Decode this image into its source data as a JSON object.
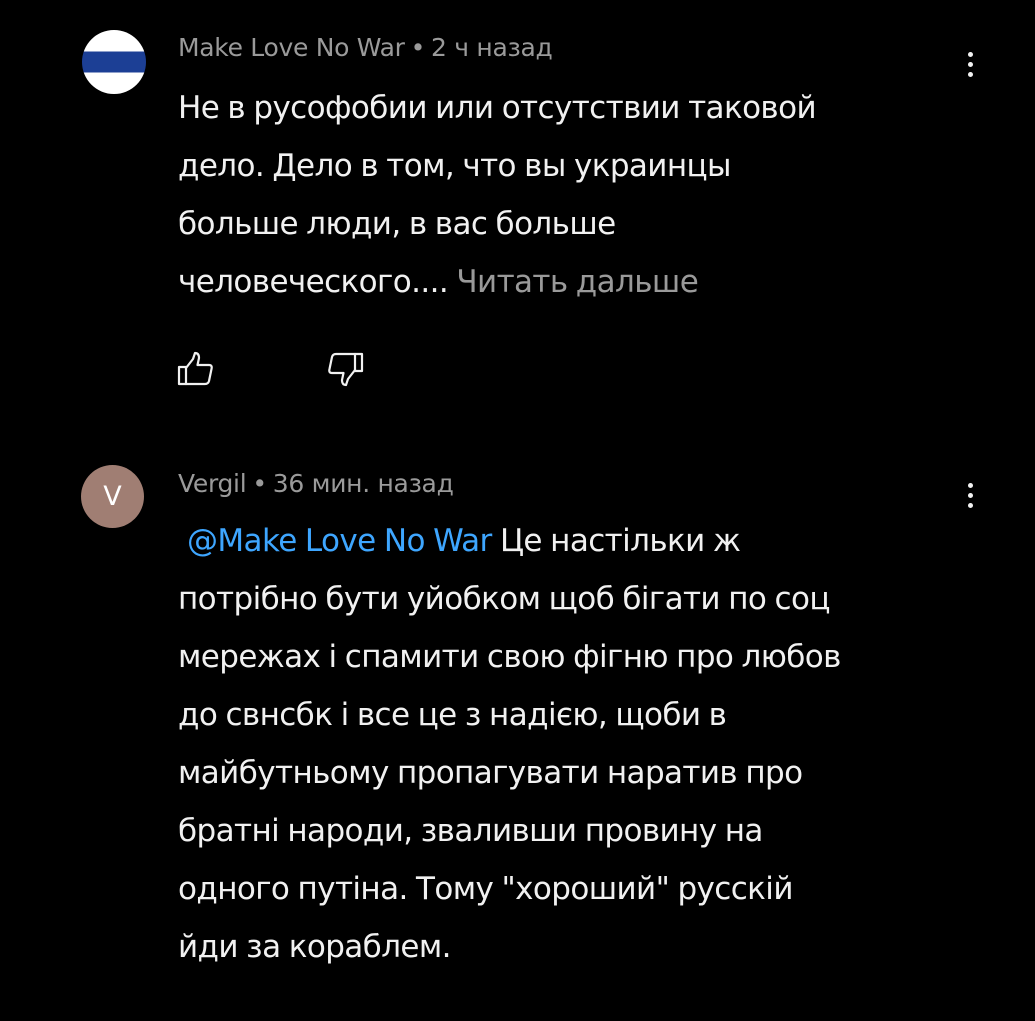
{
  "comments": [
    {
      "author": "Make Love No War",
      "separator": "•",
      "time": "2 ч назад",
      "avatar": {
        "type": "flag",
        "colors": [
          "#ffffff",
          "#1c3f95",
          "#ffffff"
        ]
      },
      "body_lines": [
        "Не в русофобии или отсутствии таковой",
        "дело. Дело в том, что вы украинцы",
        "больше люди, в вас больше",
        "человеческого...."
      ],
      "read_more": "Читать дальше",
      "actions": {
        "like_icon": "thumbs-up-icon",
        "dislike_icon": "thumbs-down-icon"
      },
      "menu_icon": "more-vertical-icon"
    },
    {
      "author": "Vergil",
      "separator": "•",
      "time": "36 мин. назад",
      "avatar": {
        "type": "letter",
        "letter": "V",
        "color": "#a07e73"
      },
      "mention": "@Make Love No War",
      "body_first_line_rest": "Це настільки ж",
      "body_lines": [
        "потрібно бути уйобком щоб бігати по соц",
        "мережах  і спамити свою фігню про любов",
        "до свнсбк і все це з надією, щоби в",
        "майбутньому пропагувати наратив про",
        "братні народи, зваливши провину на",
        "одного путіна. Тому  \"хороший\" русскій",
        "йди за кораблем."
      ],
      "menu_icon": "more-vertical-icon"
    }
  ],
  "colors": {
    "background": "#000000",
    "text": "#f1f1f1",
    "secondary_text": "#9a9a9a",
    "mention": "#3ea6ff"
  }
}
